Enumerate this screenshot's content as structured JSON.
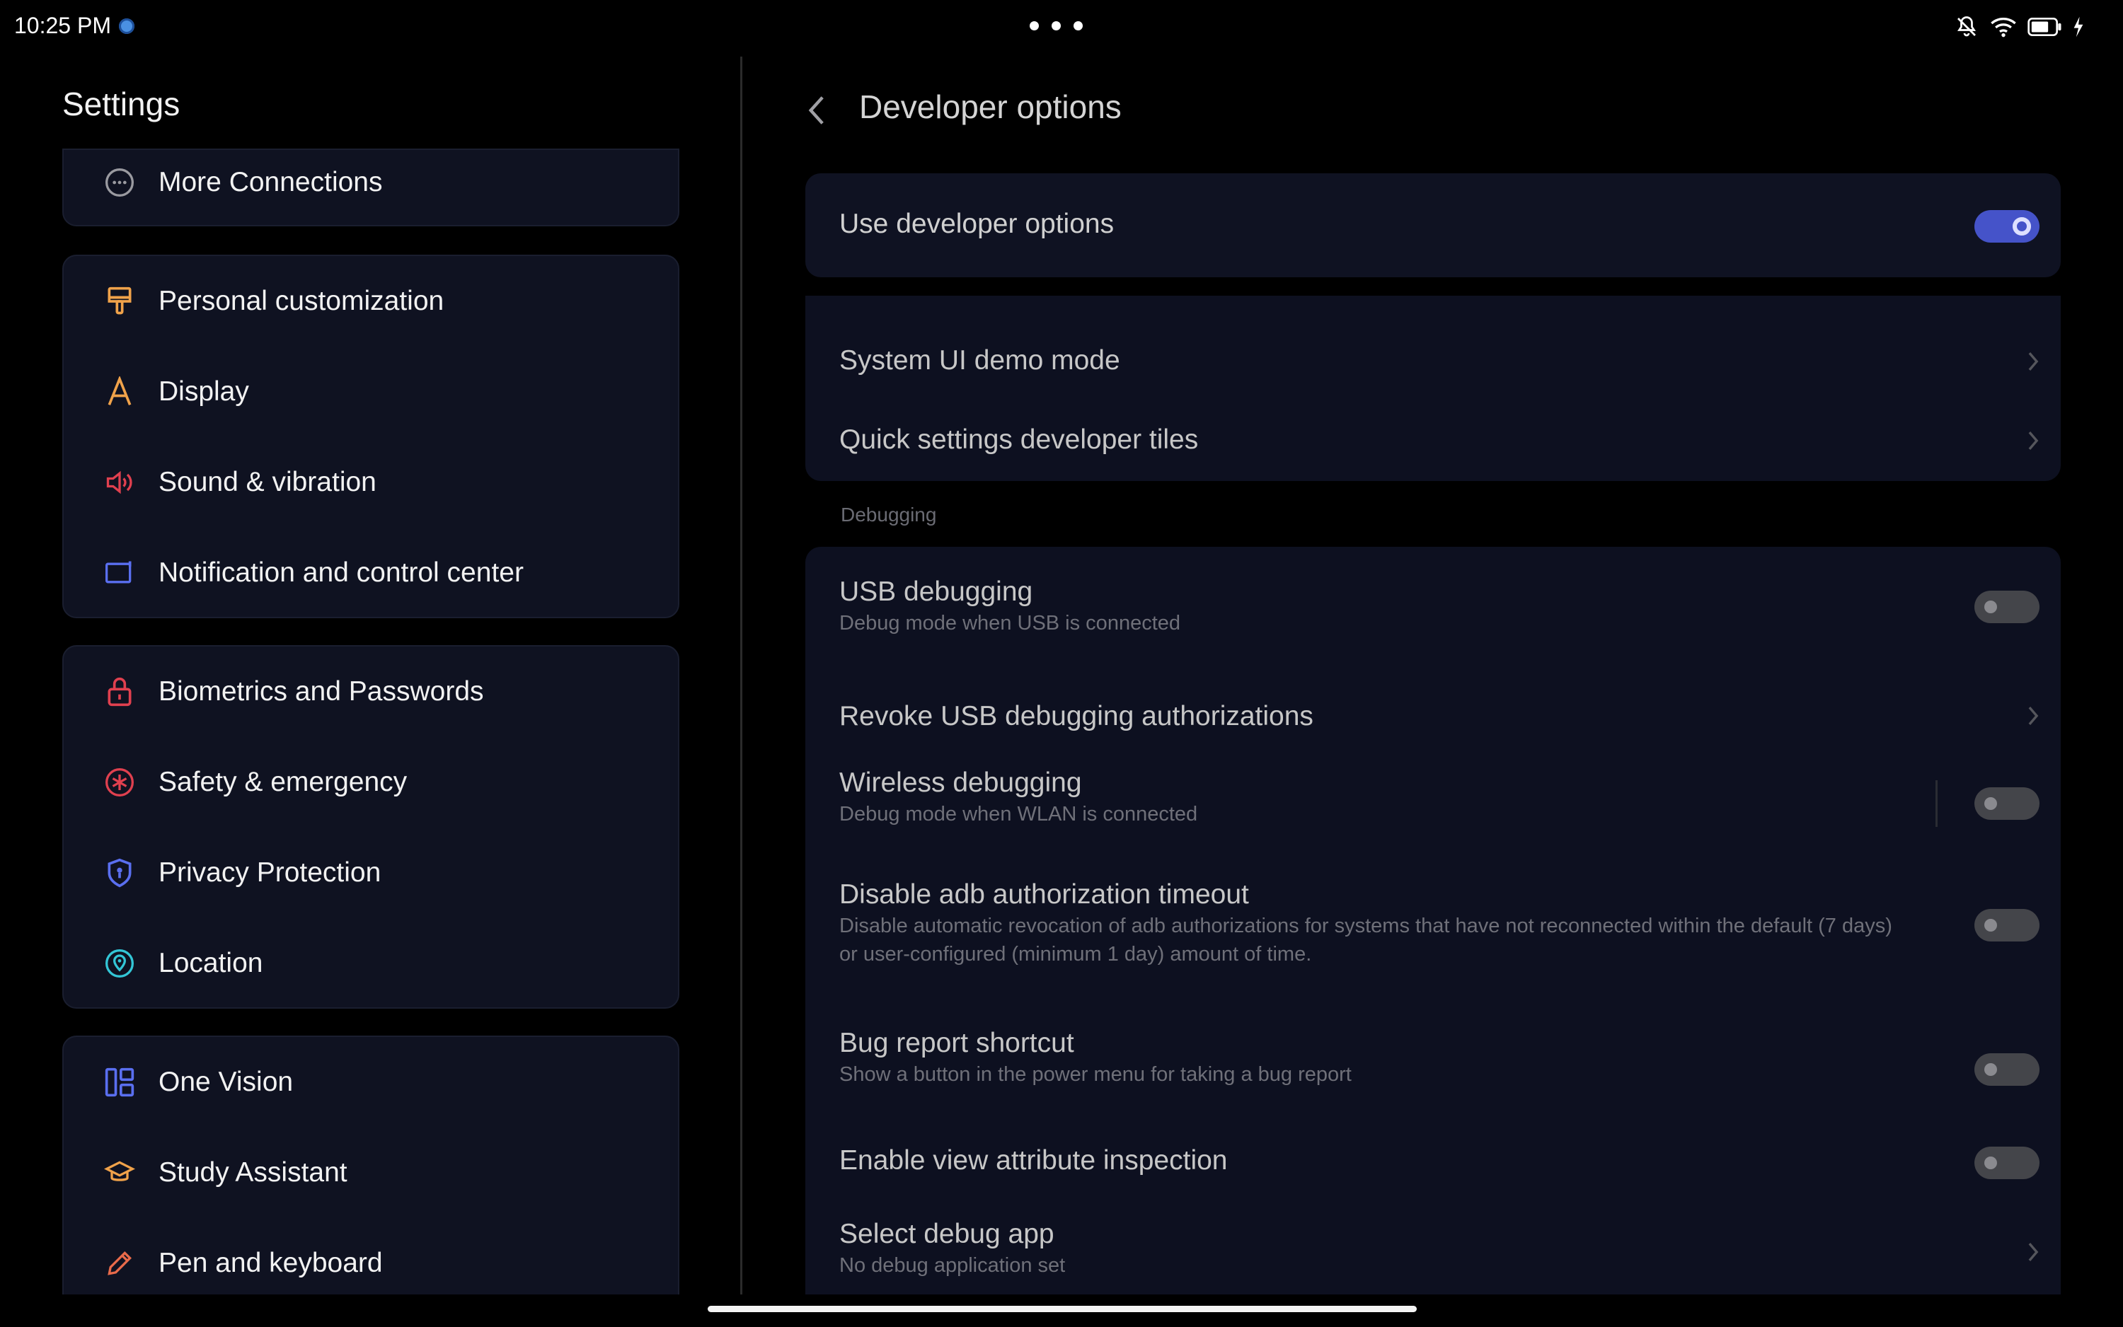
{
  "status_bar": {
    "time": "10:25 PM",
    "icons": [
      "notification-dot-icon",
      "bell-off-icon",
      "wifi-icon",
      "battery-icon",
      "charging-icon"
    ]
  },
  "left": {
    "title": "Settings",
    "groups": [
      {
        "items": [
          {
            "label": "More Connections",
            "icon": "more-connections-icon"
          }
        ]
      },
      {
        "items": [
          {
            "label": "Personal customization",
            "icon": "brush-icon"
          },
          {
            "label": "Display",
            "icon": "display-letter-icon"
          },
          {
            "label": "Sound & vibration",
            "icon": "speaker-icon"
          },
          {
            "label": "Notification and control center",
            "icon": "notification-panel-icon"
          }
        ]
      },
      {
        "items": [
          {
            "label": "Biometrics and Passwords",
            "icon": "lock-icon"
          },
          {
            "label": "Safety & emergency",
            "icon": "emergency-icon"
          },
          {
            "label": "Privacy Protection",
            "icon": "shield-icon"
          },
          {
            "label": "Location",
            "icon": "location-pin-icon"
          }
        ]
      },
      {
        "items": [
          {
            "label": "One Vision",
            "icon": "one-vision-icon"
          },
          {
            "label": "Study Assistant",
            "icon": "graduation-cap-icon"
          },
          {
            "label": "Pen and keyboard",
            "icon": "pen-icon"
          }
        ]
      }
    ]
  },
  "right": {
    "title": "Developer options",
    "use_dev": {
      "label": "Use developer options",
      "enabled": true
    },
    "system": [
      {
        "label": "System UI demo mode"
      },
      {
        "label": "Quick settings developer tiles"
      }
    ],
    "section_debugging": "Debugging",
    "debug": [
      {
        "title": "USB debugging",
        "subtitle": "Debug mode when USB is connected",
        "type": "toggle",
        "on": false
      },
      {
        "title": "Revoke USB debugging authorizations",
        "subtitle": "",
        "type": "chevron"
      },
      {
        "title": "Wireless debugging",
        "subtitle": "Debug mode when WLAN is connected",
        "type": "toggle",
        "on": false
      },
      {
        "title": "Disable adb authorization timeout",
        "subtitle_line1": "Disable automatic revocation of adb authorizations for systems that have not reconnected within the default (7 days)",
        "subtitle_line2": "or user-configured (minimum 1 day) amount of time.",
        "type": "toggle",
        "on": false
      },
      {
        "title": "Bug report shortcut",
        "subtitle": "Show a button in the power menu for taking a bug report",
        "type": "toggle",
        "on": false
      },
      {
        "title": "Enable view attribute inspection",
        "subtitle": "",
        "type": "toggle",
        "on": false
      },
      {
        "title": "Select debug app",
        "subtitle": "No debug application set",
        "type": "chevron"
      }
    ]
  },
  "colors": {
    "background": "#000000",
    "card": "#0f1221",
    "accent_toggle": "#4553c9",
    "orange_icon": "#f0a24a",
    "red_icon": "#e0404f",
    "blue_icon": "#5a6ff0",
    "teal_icon": "#33c6d6"
  }
}
